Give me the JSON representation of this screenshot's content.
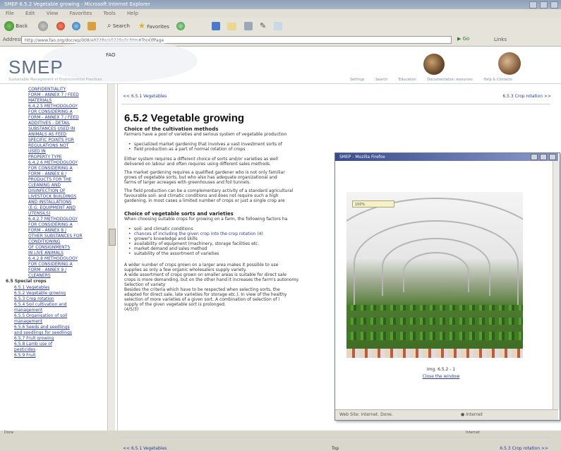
{
  "window": {
    "title": "SMEP 6.5.2 Vegetable growing - Microsoft Internet Explorer"
  },
  "menubar": [
    "File",
    "Edit",
    "View",
    "Favorites",
    "Tools",
    "Help"
  ],
  "toolbar": {
    "back": "Back",
    "search": "Search",
    "favorites": "Favorites"
  },
  "address": {
    "label": "Address",
    "url": "http://www.fao.org/docrep/008/a0228e/a0228e0r.htm#TopOfPage",
    "go": "Go",
    "links": "Links"
  },
  "header": {
    "logo": "SMEP",
    "logo_sub": "Sustainable Management of Environmental Practices",
    "org": "FAO",
    "nav": [
      "Settings",
      "Search",
      "Education",
      "Documentation resources",
      "Help & Contacts"
    ]
  },
  "sidebar": {
    "items": [
      {
        "text": "CONFIDENTIALITY",
        "level": 2
      },
      {
        "text": "FORM - ANNEX 7 / FEED",
        "level": 2
      },
      {
        "text": "MATERIALS",
        "level": 2
      },
      {
        "text": "6.4.2.5 METHODOLOGY",
        "level": 2
      },
      {
        "text": "FOR CONSIDERING A",
        "level": 2
      },
      {
        "text": "FORM - ANNEX 7 / FEED",
        "level": 2
      },
      {
        "text": "ADDITIVES - DETAIL",
        "level": 2
      },
      {
        "text": "SUBSTANCES USED IN",
        "level": 2
      },
      {
        "text": "ANIMALS AS FEED",
        "level": 2
      },
      {
        "text": "SPECIFIC POINTS FOR",
        "level": 2
      },
      {
        "text": "REGULATIONS NOT",
        "level": 2
      },
      {
        "text": "USED IN",
        "level": 2
      },
      {
        "text": "PROPERTY TYPE",
        "level": 2
      },
      {
        "text": "6.4.2.6 METHODOLOGY",
        "level": 2
      },
      {
        "text": "FOR CONSIDERING A",
        "level": 2
      },
      {
        "text": "FORM - ANNEX 6 /",
        "level": 2
      },
      {
        "text": "PRODUCTS FOR THE",
        "level": 2
      },
      {
        "text": "CLEANING AND",
        "level": 2
      },
      {
        "text": "DISINFECTION OF",
        "level": 2
      },
      {
        "text": "LIVESTOCK BUILDINGS",
        "level": 2
      },
      {
        "text": "AND INSTALLATIONS",
        "level": 2
      },
      {
        "text": "(E.G. EQUIPMENT AND",
        "level": 2
      },
      {
        "text": "UTENSILS)",
        "level": 2
      },
      {
        "text": "6.4.2.7 METHODOLOGY",
        "level": 2
      },
      {
        "text": "FOR CONSIDERING A",
        "level": 2
      },
      {
        "text": "FORM - ANNEX 8 /",
        "level": 2
      },
      {
        "text": "OTHER SUBSTANCES FOR",
        "level": 2
      },
      {
        "text": "CONDITIONING",
        "level": 2
      },
      {
        "text": "OF CONSIGNMENTS",
        "level": 2
      },
      {
        "text": "IN LIVE ANIMALS",
        "level": 2
      },
      {
        "text": "6.4.2.8 METHODOLOGY",
        "level": 2
      },
      {
        "text": "FOR CONSIDERING A",
        "level": 2
      },
      {
        "text": "FORM - ANNEX 9 /",
        "level": 2
      },
      {
        "text": "CLEANERS",
        "level": 2
      },
      {
        "text": "6.5 Special crops",
        "level": 0
      },
      {
        "text": "6.5.1 Vegetables",
        "level": 1
      },
      {
        "text": "6.5.2 Vegetable growing",
        "level": 1
      },
      {
        "text": "6.5.3 Crop rotation",
        "level": 1
      },
      {
        "text": "6.5.4 Soil cultivation and",
        "level": 1
      },
      {
        "text": "management",
        "level": 1
      },
      {
        "text": "6.5.5 Organisation of soil",
        "level": 1
      },
      {
        "text": "management",
        "level": 1
      },
      {
        "text": "6.5.6 Seeds and seedlings",
        "level": 1
      },
      {
        "text": "and seedlings for seedlings",
        "level": 1
      },
      {
        "text": "6.5.7 Fruit growing",
        "level": 1
      },
      {
        "text": "6.5.8 Lamb use of",
        "level": 1
      },
      {
        "text": "pesticides",
        "level": 1
      },
      {
        "text": "6.5.9 Fruit",
        "level": 1
      }
    ]
  },
  "content": {
    "prev_link": "<< 6.5.1 Vegetables",
    "next_link": "6.5.3 Crop rotation >>",
    "title": "6.5.2 Vegetable growing",
    "section1_heading": "Choice of the cultivation methods",
    "section1_intro": "Farmers have a pool of varieties and serious system of vegetable production",
    "bullets1": [
      "specialized market gardening that involves a vast investment sorts of",
      "field production as a part of normal rotation of crops"
    ],
    "para1": [
      "Either system requires a different choice of sorts and/or varieties as well",
      "delivered on labour and often requires using different sales methods."
    ],
    "para2": [
      "The market gardening requires a qualified gardener who is not only familiar",
      "grows of vegetable sorts, but who also has adequate organizational and",
      "farms of larger acreages with greenhouses and foil tunnels."
    ],
    "para3": [
      "The field production can be a complementary activity of a standard agricultural",
      "favourable soil- and climatic conditions and does not require such a high",
      "gardening, in most cases a limited number of crops or just a single crop are"
    ],
    "section2_heading": "Choice of vegetable sorts and varieties",
    "section2_intro": "When choosing suitable crops for growing on a farm, the following factors ha",
    "bullets2": [
      "soil- and climatic conditions",
      "chances of including the given crop into the crop rotation (4)",
      "grower's knowledge and skills",
      "availability of equipment (machinery, storage facilities etc.",
      "market demand and sales method",
      "suitability of the assortment of varieties"
    ],
    "para4": [
      "A wider number of crops grown on a larger area makes it possible to use",
      "supplies as only a few organic wholesalers supply variety.",
      "A wide assortment of crops grown on smaller areas is suitable for direct sale",
      "crops is more demanding, but on the other hand it increases the farm's autonomy.",
      "Selection of variety",
      "Besides the criteria which have to be respected when selecting sorts, the",
      "adapted for direct sale, late varieties for storage etc.). In view of the healthy",
      "selection of more varieties of a given sort. A combination of selection of l",
      "supply of the given vegetable sort is prolonged.",
      "(4/5/3)"
    ],
    "bottom_prev": "<< 6.5.1 Vegetables",
    "bottom_top": "Top",
    "bottom_next": "6.5.3 Crop rotation >>"
  },
  "popup": {
    "title": "SMEP - Mozilla Firefox",
    "zoom_label": "100%",
    "caption": "Img. 6.5.2 - 1",
    "close_link": "Close the window",
    "status_left": "Web Site: Internet. Done.",
    "status_right": "Internet"
  },
  "statusbar": {
    "text": "Done",
    "zone": "Internet"
  }
}
